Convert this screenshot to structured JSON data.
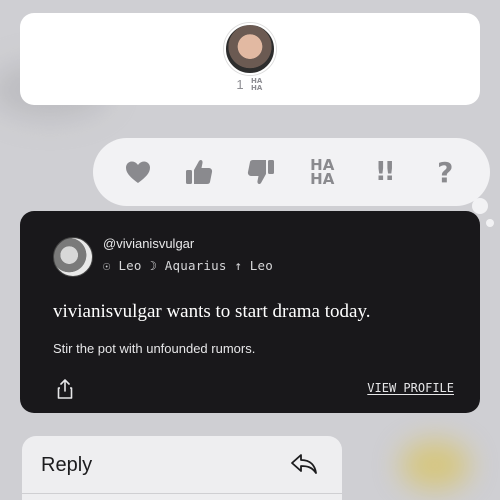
{
  "reaction_summary": {
    "count": "1",
    "reaction_text": "HA HA"
  },
  "tapbacks": [
    {
      "name": "heart",
      "icon": "heart-icon"
    },
    {
      "name": "thumbs-up",
      "icon": "thumbs-up-icon"
    },
    {
      "name": "thumbs-down",
      "icon": "thumbs-down-icon"
    },
    {
      "name": "haha",
      "label": "HA HA",
      "icon": "haha-icon"
    },
    {
      "name": "emphasize",
      "label": "!!",
      "icon": "exclamation-icon"
    },
    {
      "name": "question",
      "label": "?",
      "icon": "question-icon"
    }
  ],
  "profile_card": {
    "handle": "@vivianisvulgar",
    "signs": "☉ Leo ☽ Aquarius ↑ Leo",
    "headline": "vivianisvulgar wants to start drama today.",
    "subline": "Stir the pot with unfounded rumors.",
    "view_profile_label": "VIEW PROFILE"
  },
  "context_menu": {
    "reply_label": "Reply"
  },
  "colors": {
    "card_dark": "#19181b",
    "tapback_icon": "#8a8a8e",
    "background": "#cfcfd3"
  }
}
